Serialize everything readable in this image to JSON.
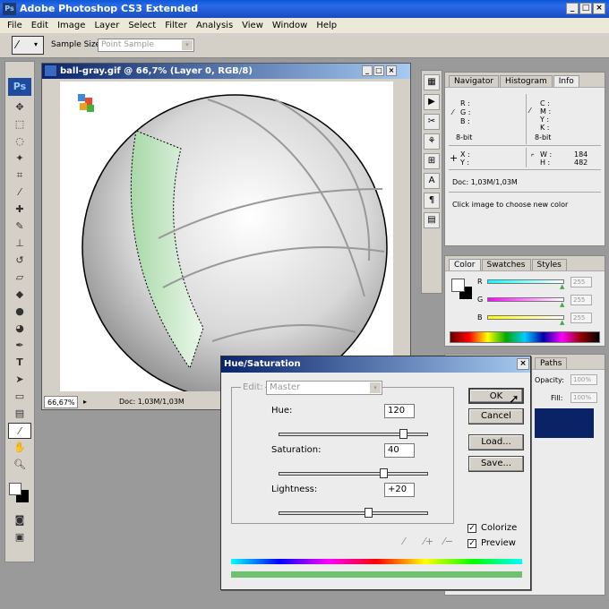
{
  "app": {
    "title": "Adobe Photoshop CS3 Extended",
    "logo": "Ps"
  },
  "menu": [
    "File",
    "Edit",
    "Image",
    "Layer",
    "Select",
    "Filter",
    "Analysis",
    "View",
    "Window",
    "Help"
  ],
  "options": {
    "sample_size_label": "Sample Size:",
    "sample_size_value": "Point Sample"
  },
  "document": {
    "title": "ball-gray.gif @ 66,7% (Layer 0, RGB/8)",
    "zoom": "66,67%",
    "doc_size": "Doc: 1,03M/1,03M"
  },
  "info_panel": {
    "tabs": [
      "Navigator",
      "Histogram",
      "Info"
    ],
    "active": "Info",
    "rgb": [
      "R :",
      "G :",
      "B :"
    ],
    "cmyk": [
      "C :",
      "M :",
      "Y :",
      "K :"
    ],
    "bit_left": "8-bit",
    "bit_right": "8-bit",
    "xy": [
      "X :",
      "Y :"
    ],
    "wh_labels": [
      "W :",
      "H :"
    ],
    "w": "184",
    "h": "482",
    "doc": "Doc: 1,03M/1,03M",
    "hint": "Click image to choose new color"
  },
  "color_panel": {
    "tabs": [
      "Color",
      "Swatches",
      "Styles"
    ],
    "active": "Color",
    "channels": [
      {
        "label": "R",
        "value": "255",
        "color": "#00ffff"
      },
      {
        "label": "G",
        "value": "255",
        "color": "#ff00ff"
      },
      {
        "label": "B",
        "value": "255",
        "color": "#ffff00"
      }
    ]
  },
  "layers_panel": {
    "tab": "Paths",
    "opacity_label": "Opacity:",
    "opacity": "100%",
    "fill_label": "Fill:",
    "fill": "100%"
  },
  "dialog": {
    "title": "Hue/Saturation",
    "edit_label": "Edit:",
    "edit_value": "Master",
    "hue_label": "Hue:",
    "hue": "120",
    "saturation_label": "Saturation:",
    "saturation": "40",
    "lightness_label": "Lightness:",
    "lightness": "+20",
    "hue_range": [
      -180,
      180
    ],
    "saturation_range": [
      -100,
      100
    ],
    "lightness_range": [
      -100,
      100
    ],
    "ok": "OK",
    "cancel": "Cancel",
    "load": "Load...",
    "save": "Save...",
    "colorize_label": "Colorize",
    "colorize": true,
    "preview_label": "Preview",
    "preview": true,
    "result_color": "#6fc06f"
  }
}
